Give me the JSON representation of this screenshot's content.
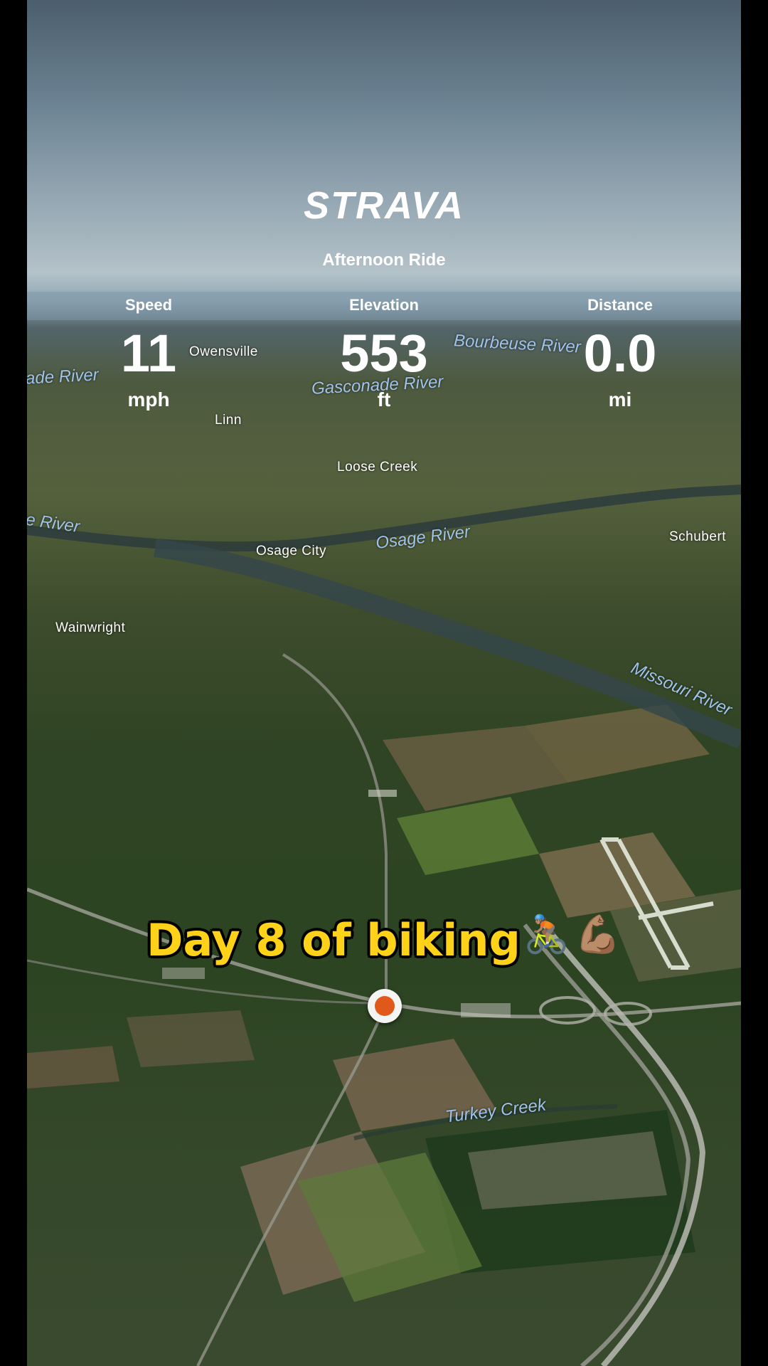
{
  "app": {
    "brand": "STRAVA",
    "activity_title": "Afternoon Ride",
    "accent_color": "#e0581a"
  },
  "stats": [
    {
      "label": "Speed",
      "value": "11",
      "unit": "mph"
    },
    {
      "label": "Elevation",
      "value": "553",
      "unit": "ft"
    },
    {
      "label": "Distance",
      "value": "0.0",
      "unit": "mi"
    }
  ],
  "map_labels": {
    "places": [
      "Owensville",
      "Linn",
      "Loose Creek",
      "Osage City",
      "Schubert",
      "Wainwright"
    ],
    "rivers": [
      "ade River",
      "Bourbeuse River",
      "Gasconade River",
      "e River",
      "Osage River",
      "Missouri River",
      "Turkey Creek"
    ]
  },
  "caption": {
    "text": "Day 8 of biking",
    "emoji_1": "🚴🏽",
    "emoji_2": "💪🏽"
  },
  "marker": {
    "icon": "position-marker-icon"
  }
}
